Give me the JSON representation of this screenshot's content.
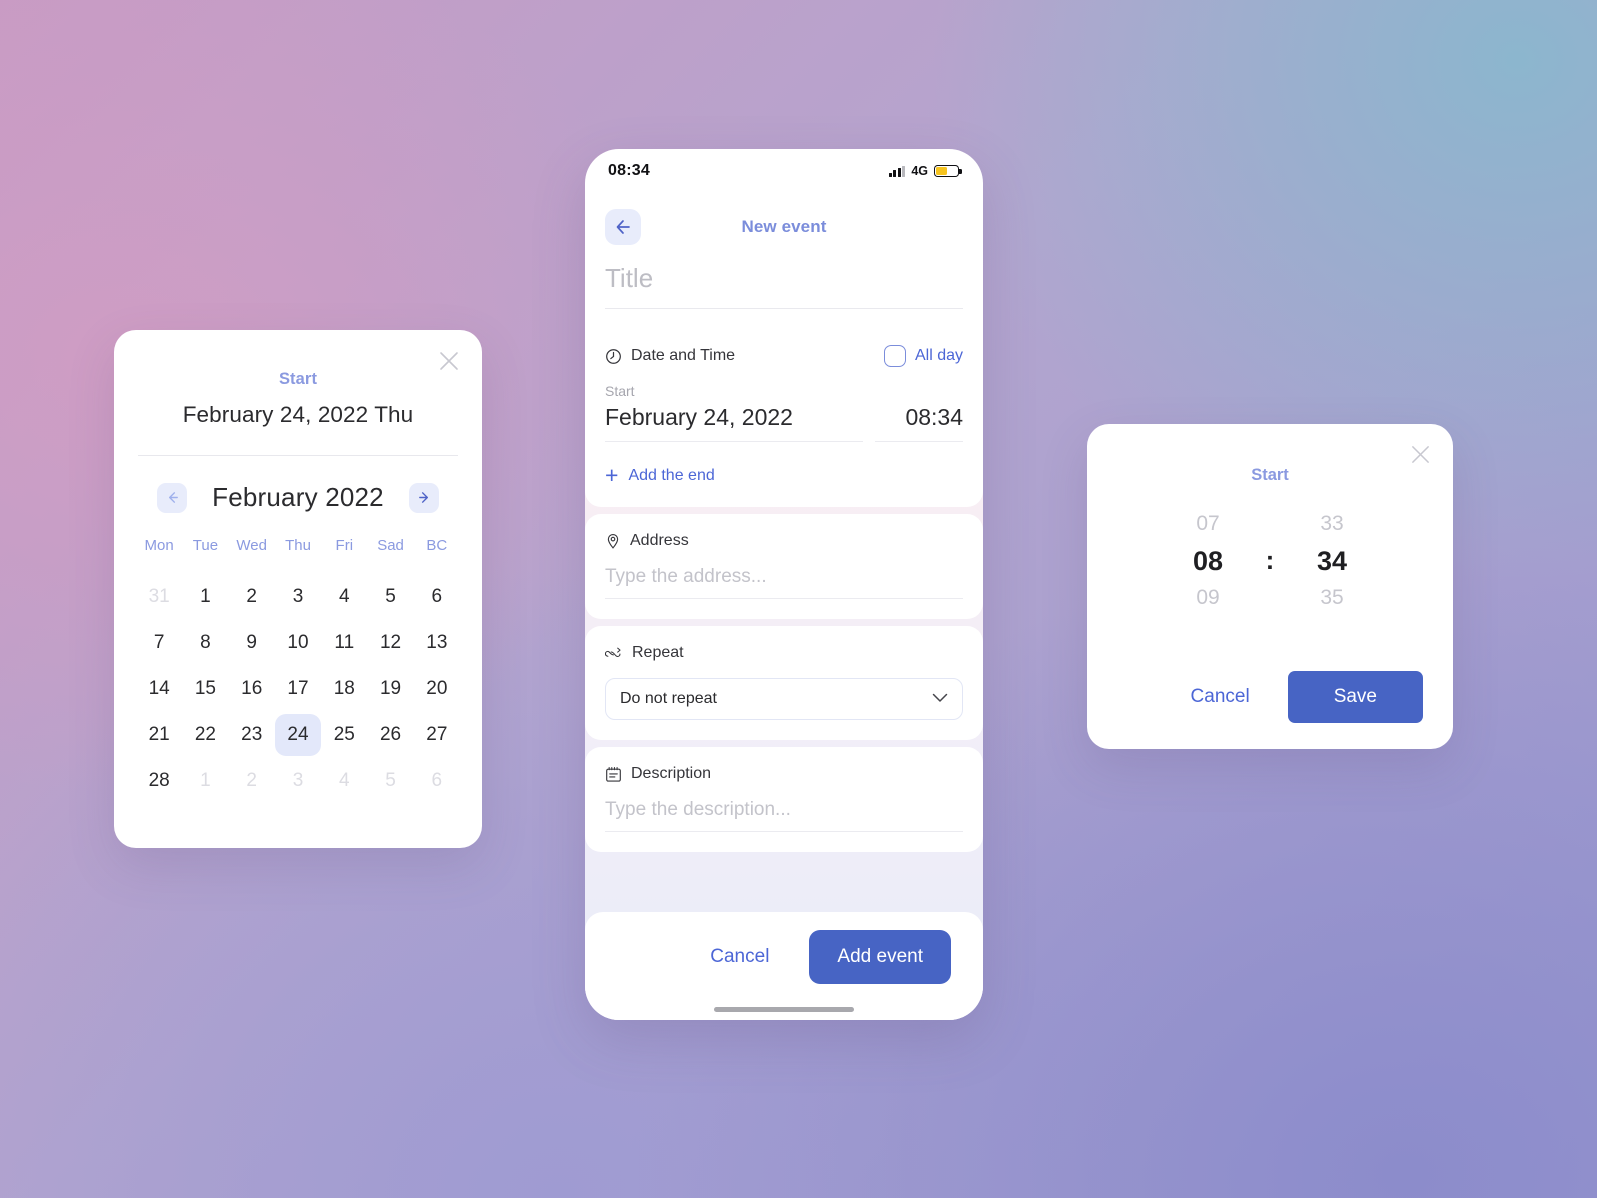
{
  "background": {
    "colors": [
      "#c89bc4",
      "#8cb6ce",
      "#8c8ccb",
      "#9a98cf"
    ]
  },
  "accent": {
    "primary_blue": "#4764c4",
    "link_blue": "#4c66d6",
    "soft_blue": "#8b9ae0",
    "chip_blue": "#e8ecfb",
    "selected_day": "#e3e8fa",
    "battery_yellow": "#f6c41f"
  },
  "calendar_modal": {
    "close_icon": "close-icon",
    "start_label": "Start",
    "selected_date_full": "February 24, 2022 Thu",
    "prev_icon": "arrow-left-icon",
    "next_icon": "arrow-right-icon",
    "month_title": "February 2022",
    "day_headers": [
      "Mon",
      "Tue",
      "Wed",
      "Thu",
      "Fri",
      "Sad",
      "BC"
    ],
    "weeks": [
      [
        {
          "d": "31",
          "muted": true
        },
        {
          "d": "1"
        },
        {
          "d": "2"
        },
        {
          "d": "3"
        },
        {
          "d": "4"
        },
        {
          "d": "5"
        },
        {
          "d": "6"
        }
      ],
      [
        {
          "d": "7"
        },
        {
          "d": "8"
        },
        {
          "d": "9"
        },
        {
          "d": "10"
        },
        {
          "d": "11"
        },
        {
          "d": "12"
        },
        {
          "d": "13"
        }
      ],
      [
        {
          "d": "14"
        },
        {
          "d": "15"
        },
        {
          "d": "16"
        },
        {
          "d": "17"
        },
        {
          "d": "18"
        },
        {
          "d": "19"
        },
        {
          "d": "20"
        }
      ],
      [
        {
          "d": "21"
        },
        {
          "d": "22"
        },
        {
          "d": "23"
        },
        {
          "d": "24",
          "selected": true
        },
        {
          "d": "25"
        },
        {
          "d": "26"
        },
        {
          "d": "27"
        }
      ],
      [
        {
          "d": "28"
        },
        {
          "d": "1",
          "muted": true
        },
        {
          "d": "2",
          "muted": true
        },
        {
          "d": "3",
          "muted": true
        },
        {
          "d": "4",
          "muted": true
        },
        {
          "d": "5",
          "muted": true
        },
        {
          "d": "6",
          "muted": true
        }
      ]
    ]
  },
  "phone": {
    "status_bar": {
      "time": "08:34",
      "signal_icon": "signal-bars-icon",
      "network": "4G",
      "battery_icon": "battery-icon",
      "battery_level_percent": 52
    },
    "header": {
      "back_icon": "arrow-left-icon",
      "title": "New event"
    },
    "title_field": {
      "value": "",
      "placeholder": "Title"
    },
    "date_time_section": {
      "icon": "clock-icon",
      "label": "Date and Time",
      "all_day_label": "All day",
      "all_day_checked": false,
      "start_label": "Start",
      "start_date": "February 24, 2022",
      "start_time": "08:34",
      "add_end_icon": "plus-icon",
      "add_end_label": "Add the end"
    },
    "address_section": {
      "icon": "location-pin-icon",
      "label": "Address",
      "value": "",
      "placeholder": "Type the address..."
    },
    "repeat_section": {
      "icon": "repeat-icon",
      "label": "Repeat",
      "selected_option": "Do not repeat",
      "chevron_icon": "chevron-down-icon"
    },
    "description_section": {
      "icon": "note-icon",
      "label": "Description",
      "value": "",
      "placeholder": "Type the description..."
    },
    "actions": {
      "cancel_label": "Cancel",
      "primary_label": "Add event"
    }
  },
  "time_modal": {
    "close_icon": "close-icon",
    "start_label": "Start",
    "hour": {
      "prev": "07",
      "current": "08",
      "next": "09"
    },
    "separator": ":",
    "minute": {
      "prev": "33",
      "current": "34",
      "next": "35"
    },
    "cancel_label": "Cancel",
    "save_label": "Save"
  }
}
